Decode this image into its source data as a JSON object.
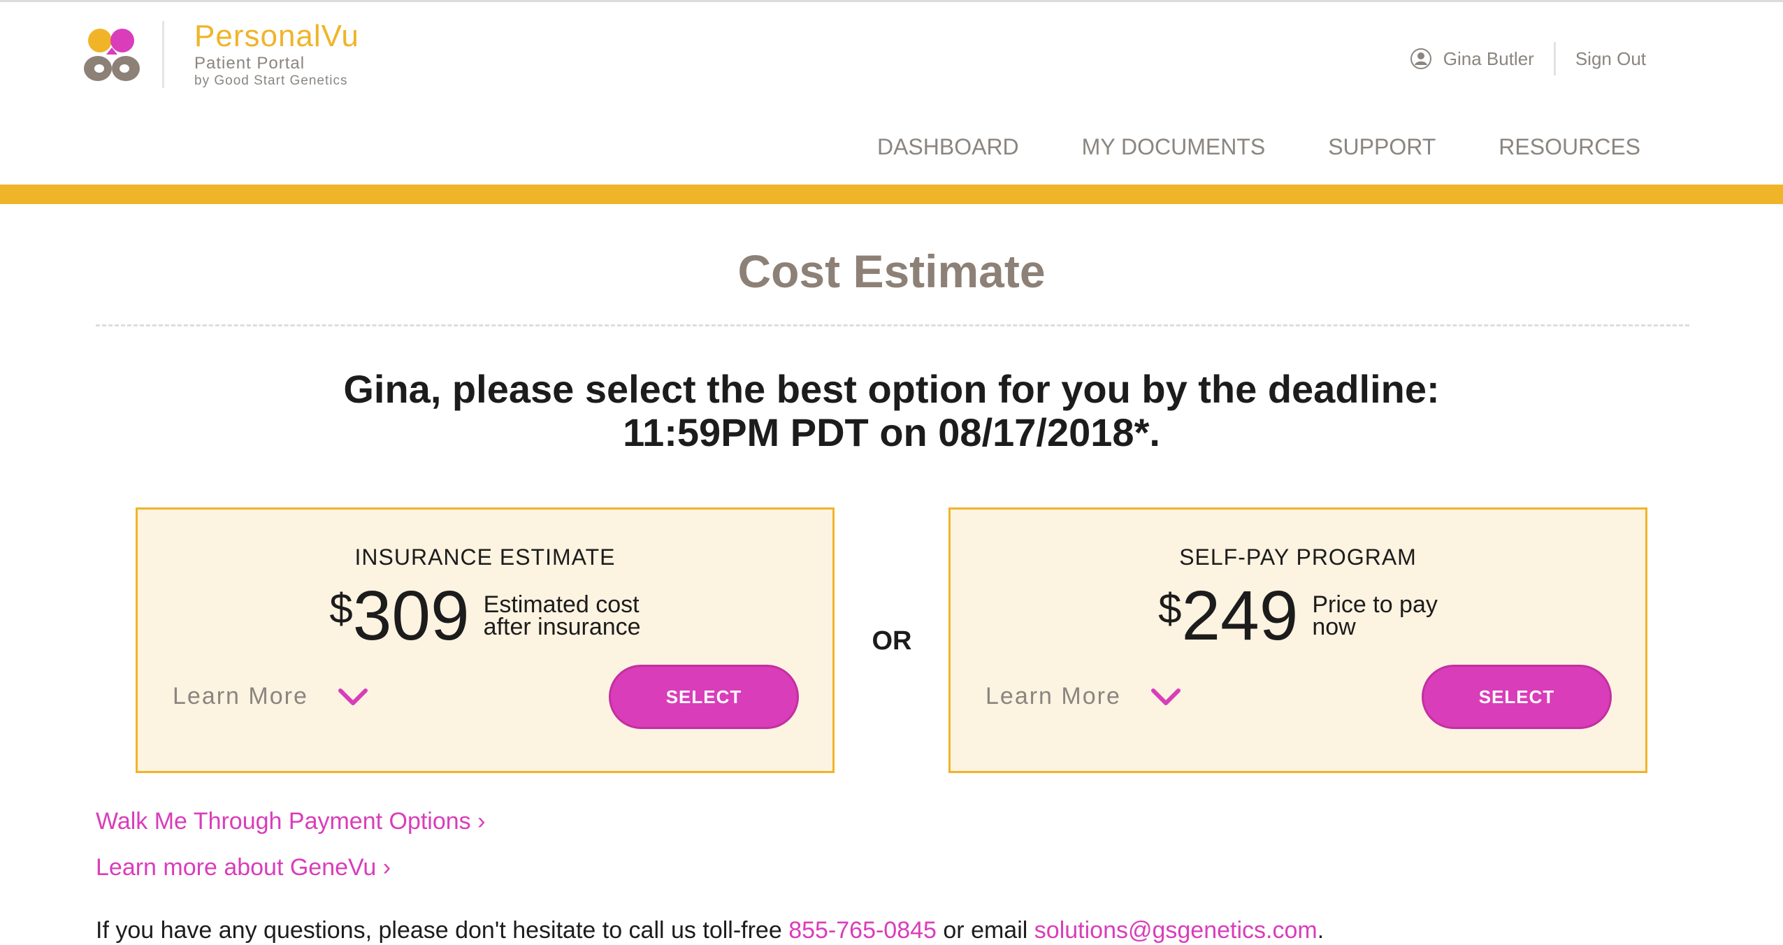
{
  "header": {
    "brand_name": "PersonalVu",
    "brand_subtitle": "Patient Portal",
    "brand_by": "by Good Start Genetics",
    "user_name": "Gina Butler",
    "sign_out": "Sign Out",
    "logo_icon": "personalvu-logo-icon",
    "user_icon": "user-icon"
  },
  "nav": [
    "DASHBOARD",
    "MY DOCUMENTS",
    "SUPPORT",
    "RESOURCES"
  ],
  "page": {
    "title": "Cost Estimate",
    "prompt_line1": "Gina, please select the best option for you by the deadline:",
    "prompt_line2": "11:59PM PDT on 08/17/2018*."
  },
  "options": [
    {
      "heading": "INSURANCE ESTIMATE",
      "currency": "$",
      "amount": "309",
      "desc_line1": "Estimated cost",
      "desc_line2": "after insurance",
      "learn_more": "Learn More",
      "select": "SELECT"
    },
    {
      "heading": "SELF-PAY PROGRAM",
      "currency": "$",
      "amount": "249",
      "desc_line1": "Price to pay",
      "desc_line2": "now",
      "learn_more": "Learn More",
      "select": "SELECT"
    }
  ],
  "or_label": "OR",
  "links": {
    "walk_through": "Walk Me Through Payment Options ›",
    "learn_genevu": "Learn more about GeneVu ›"
  },
  "contact": {
    "text_before": "If you have any questions, please don't hesitate to call us toll-free ",
    "phone": "855-765-0845",
    "text_middle": " or email ",
    "email": "solutions@gsgenetics.com",
    "text_after": "."
  },
  "colors": {
    "accent_gold": "#f0b429",
    "accent_magenta": "#d93dba",
    "card_bg": "#fdf3e1",
    "muted_text": "#8a8580"
  }
}
